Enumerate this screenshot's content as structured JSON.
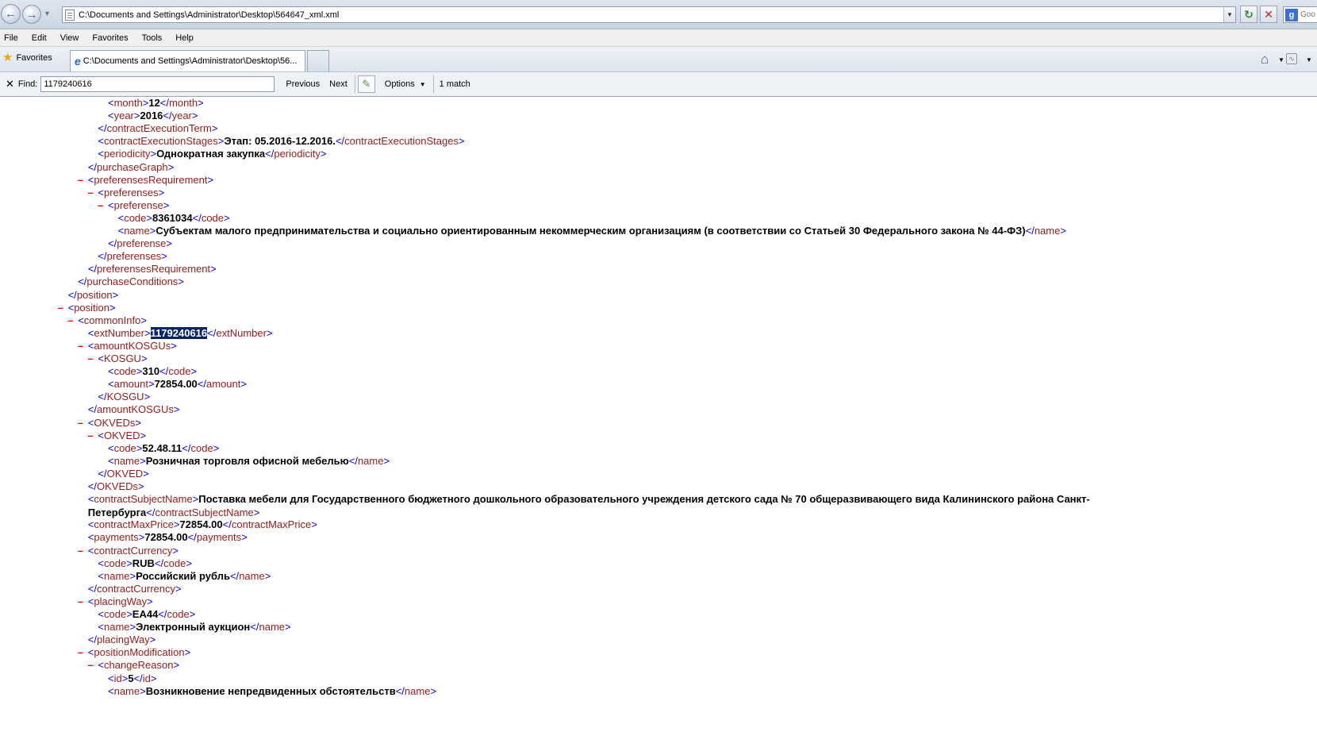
{
  "browser": {
    "address": "C:\\Documents and Settings\\Administrator\\Desktop\\564647_xml.xml",
    "tab_title": "C:\\Documents and Settings\\Administrator\\Desktop\\56...",
    "search_placeholder": "Goo",
    "search_logo": "g",
    "menu": [
      "File",
      "Edit",
      "View",
      "Favorites",
      "Tools",
      "Help"
    ],
    "favorites_label": "Favorites"
  },
  "find": {
    "label": "Find:",
    "value": "1179240616",
    "previous": "Previous",
    "next": "Next",
    "options": "Options",
    "result": "1 match"
  },
  "icons": {
    "back": "back-arrow-icon",
    "forward": "forward-arrow-icon",
    "refresh": "refresh-icon",
    "stop": "stop-icon",
    "favorites": "star-icon",
    "home": "home-icon",
    "feed": "rss-feed-icon",
    "find_close": "close-icon",
    "highlight": "highlighter-pencil-icon",
    "tab": "ie-page-icon"
  },
  "xml_lines": [
    {
      "indent": 10,
      "open": "month",
      "text": "12",
      "close": "month"
    },
    {
      "indent": 10,
      "open": "year",
      "text": "2016",
      "close": "year"
    },
    {
      "indent": 9,
      "close_only": "contractExecutionTerm"
    },
    {
      "indent": 9,
      "open": "contractExecutionStages",
      "text": "Этап: 05.2016-12.2016.",
      "close": "contractExecutionStages"
    },
    {
      "indent": 9,
      "open": "periodicity",
      "text": "Однократная закупка",
      "close": "periodicity"
    },
    {
      "indent": 8,
      "close_only": "purchaseGraph"
    },
    {
      "indent": 8,
      "minus": true,
      "open_only": "preferensesRequirement"
    },
    {
      "indent": 9,
      "minus": true,
      "open_only": "preferenses"
    },
    {
      "indent": 10,
      "minus": true,
      "open_only": "preferense"
    },
    {
      "indent": 11,
      "open": "code",
      "text": "8361034",
      "close": "code"
    },
    {
      "indent": 11,
      "open": "name",
      "text": "Субъектам малого предпринимательства и социально ориентированным некоммерческим организациям (в соответствии со Статьей 30 Федерального закона № 44-ФЗ)",
      "close": "name"
    },
    {
      "indent": 10,
      "close_only": "preferense"
    },
    {
      "indent": 9,
      "close_only": "preferenses"
    },
    {
      "indent": 8,
      "close_only": "preferensesRequirement"
    },
    {
      "indent": 7,
      "close_only": "purchaseConditions"
    },
    {
      "indent": 6,
      "close_only": "position"
    },
    {
      "indent": 6,
      "minus": true,
      "open_only": "position"
    },
    {
      "indent": 7,
      "minus": true,
      "open_only": "commonInfo"
    },
    {
      "indent": 8,
      "open": "extNumber",
      "text": "1179240616",
      "close": "extNumber",
      "highlight": true
    },
    {
      "indent": 8,
      "minus": true,
      "open_only": "amountKOSGUs"
    },
    {
      "indent": 9,
      "minus": true,
      "open_only": "KOSGU"
    },
    {
      "indent": 10,
      "open": "code",
      "text": "310",
      "close": "code"
    },
    {
      "indent": 10,
      "open": "amount",
      "text": "72854.00",
      "close": "amount"
    },
    {
      "indent": 9,
      "close_only": "KOSGU"
    },
    {
      "indent": 8,
      "close_only": "amountKOSGUs"
    },
    {
      "indent": 8,
      "minus": true,
      "open_only": "OKVEDs"
    },
    {
      "indent": 9,
      "minus": true,
      "open_only": "OKVED"
    },
    {
      "indent": 10,
      "open": "code",
      "text": "52.48.11",
      "close": "code"
    },
    {
      "indent": 10,
      "open": "name",
      "text": "Розничная торговля офисной мебелью",
      "close": "name"
    },
    {
      "indent": 9,
      "close_only": "OKVED"
    },
    {
      "indent": 8,
      "close_only": "OKVEDs"
    },
    {
      "indent": 8,
      "open": "contractSubjectName",
      "text": "Поставка мебели для Государственного бюджетного дошкольного образовательного учреждения детского сада № 70 общеразвивающего вида Калининского района Санкт-Петербурга",
      "close": "contractSubjectName",
      "wrap": true
    },
    {
      "indent": 8,
      "open": "contractMaxPrice",
      "text": "72854.00",
      "close": "contractMaxPrice"
    },
    {
      "indent": 8,
      "open": "payments",
      "text": "72854.00",
      "close": "payments"
    },
    {
      "indent": 8,
      "minus": true,
      "open_only": "contractCurrency"
    },
    {
      "indent": 9,
      "open": "code",
      "text": "RUB",
      "close": "code"
    },
    {
      "indent": 9,
      "open": "name",
      "text": "Российский рубль",
      "close": "name"
    },
    {
      "indent": 8,
      "close_only": "contractCurrency"
    },
    {
      "indent": 8,
      "minus": true,
      "open_only": "placingWay"
    },
    {
      "indent": 9,
      "open": "code",
      "text": "EA44",
      "close": "code"
    },
    {
      "indent": 9,
      "open": "name",
      "text": "Электронный аукцион",
      "close": "name"
    },
    {
      "indent": 8,
      "close_only": "placingWay"
    },
    {
      "indent": 8,
      "minus": true,
      "open_only": "positionModification"
    },
    {
      "indent": 9,
      "minus": true,
      "open_only": "changeReason"
    },
    {
      "indent": 10,
      "open": "id",
      "text": "5",
      "close": "id"
    },
    {
      "indent": 10,
      "open": "name",
      "text": "Возникновение непредвиденных обстоятельств",
      "close": "name"
    }
  ]
}
